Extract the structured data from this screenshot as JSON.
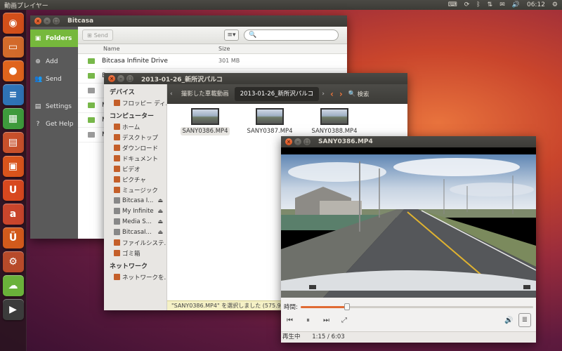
{
  "panel": {
    "app_title": "動画プレイヤー",
    "time": "06:12"
  },
  "launcher": [
    {
      "name": "ubuntu-dash-icon",
      "glyph": "◉",
      "color": "#d34f1a"
    },
    {
      "name": "files-icon",
      "glyph": "▭",
      "color": "#d36a2b"
    },
    {
      "name": "firefox-icon",
      "glyph": "●",
      "color": "#e0641d"
    },
    {
      "name": "writer-icon",
      "glyph": "≡",
      "color": "#2f73b6"
    },
    {
      "name": "calc-icon",
      "glyph": "▦",
      "color": "#3e9a3c"
    },
    {
      "name": "impress-icon",
      "glyph": "▤",
      "color": "#c7502b"
    },
    {
      "name": "software-center-icon",
      "glyph": "▣",
      "color": "#d9541c"
    },
    {
      "name": "ubuntu-one-icon",
      "glyph": "U",
      "color": "#d8481f"
    },
    {
      "name": "amazon-icon",
      "glyph": "a",
      "color": "#c9452c"
    },
    {
      "name": "ubuntu-one-music-icon",
      "glyph": "Ü",
      "color": "#d25a1c"
    },
    {
      "name": "settings-icon",
      "glyph": "⚙",
      "color": "#b74a2a"
    },
    {
      "name": "bitcasa-icon",
      "glyph": "☁",
      "color": "#6ab13a"
    },
    {
      "name": "video-player-icon",
      "glyph": "▶",
      "color": "#3b3b3b"
    }
  ],
  "bitcasa": {
    "title": "Bitcasa",
    "nav": {
      "folders": "Folders",
      "add": "Add",
      "send": "Send",
      "settings": "Settings",
      "help": "Get Help"
    },
    "send_button": "Send",
    "view_button": "≡▾",
    "search_placeholder": "",
    "columns": {
      "name": "Name",
      "size": "Size"
    },
    "rows": [
      {
        "name": "Bitcasa Infinite Drive",
        "size": "301 MB"
      },
      {
        "name": "B",
        "size": ""
      },
      {
        "name": "",
        "size": ""
      },
      {
        "name": "M",
        "size": ""
      },
      {
        "name": "M",
        "size": ""
      },
      {
        "name": "M",
        "size": ""
      }
    ]
  },
  "filemgr": {
    "title": "2013-01-26_新所沢パルコ",
    "devices_header": "デバイス",
    "devices": [
      "フロッピー ディ..."
    ],
    "computer_header": "コンピューター",
    "computer": [
      "ホーム",
      "デスクトップ",
      "ダウンロード",
      "ドキュメント",
      "ビデオ",
      "ピクチャ",
      "ミュージック",
      "Bitcasa I...",
      "My Infinite",
      "Media S...",
      "BitcasaI...",
      "ファイルシステ...",
      "ゴミ箱"
    ],
    "network_header": "ネットワーク",
    "network": [
      "ネットワークを..."
    ],
    "breadcrumbs": [
      "撮影した車載動画",
      "2013-01-26_新所沢パルコ"
    ],
    "search_label": "検索",
    "files": [
      "SANY0386.MP4",
      "SANY0387.MP4",
      "SANY0388.MP4"
    ],
    "status": "\"SANY0386.MP4\" を選択しました (575.9"
  },
  "player": {
    "title": "SANY0386.MP4",
    "time_label": "時間:",
    "progress": 0.2,
    "state": "再生中",
    "time": "1:15 / 6:03"
  }
}
